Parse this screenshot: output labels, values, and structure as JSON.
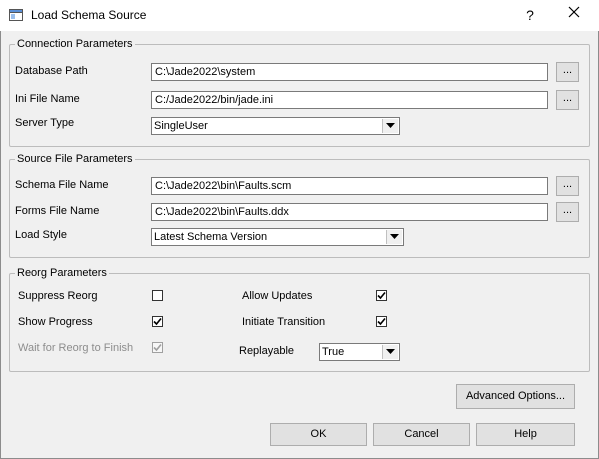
{
  "window": {
    "title": "Load Schema Source",
    "help_glyph": "?",
    "close_glyph": "✕"
  },
  "connection": {
    "legend": "Connection Parameters",
    "database_path_label": "Database Path",
    "database_path_value": "C:\\Jade2022\\system",
    "ini_file_label": "Ini File Name",
    "ini_file_value": "C:/Jade2022/bin/jade.ini",
    "server_type_label": "Server Type",
    "server_type_value": "SingleUser",
    "browse_label": "..."
  },
  "source": {
    "legend": "Source File Parameters",
    "schema_file_label": "Schema File Name",
    "schema_file_value": "C:\\Jade2022\\bin\\Faults.scm",
    "forms_file_label": "Forms File Name",
    "forms_file_value": "C:\\Jade2022\\bin\\Faults.ddx",
    "load_style_label": "Load Style",
    "load_style_value": "Latest Schema Version",
    "browse_label": "..."
  },
  "reorg": {
    "legend": "Reorg Parameters",
    "suppress_reorg_label": "Suppress Reorg",
    "suppress_reorg_checked": false,
    "show_progress_label": "Show Progress",
    "show_progress_checked": true,
    "wait_label": "Wait for Reorg to Finish",
    "wait_checked": true,
    "allow_updates_label": "Allow Updates",
    "allow_updates_checked": true,
    "initiate_transition_label": "Initiate Transition",
    "initiate_transition_checked": true,
    "replayable_label": "Replayable",
    "replayable_value": "True"
  },
  "buttons": {
    "advanced": "Advanced Options...",
    "ok": "OK",
    "cancel": "Cancel",
    "help": "Help"
  }
}
